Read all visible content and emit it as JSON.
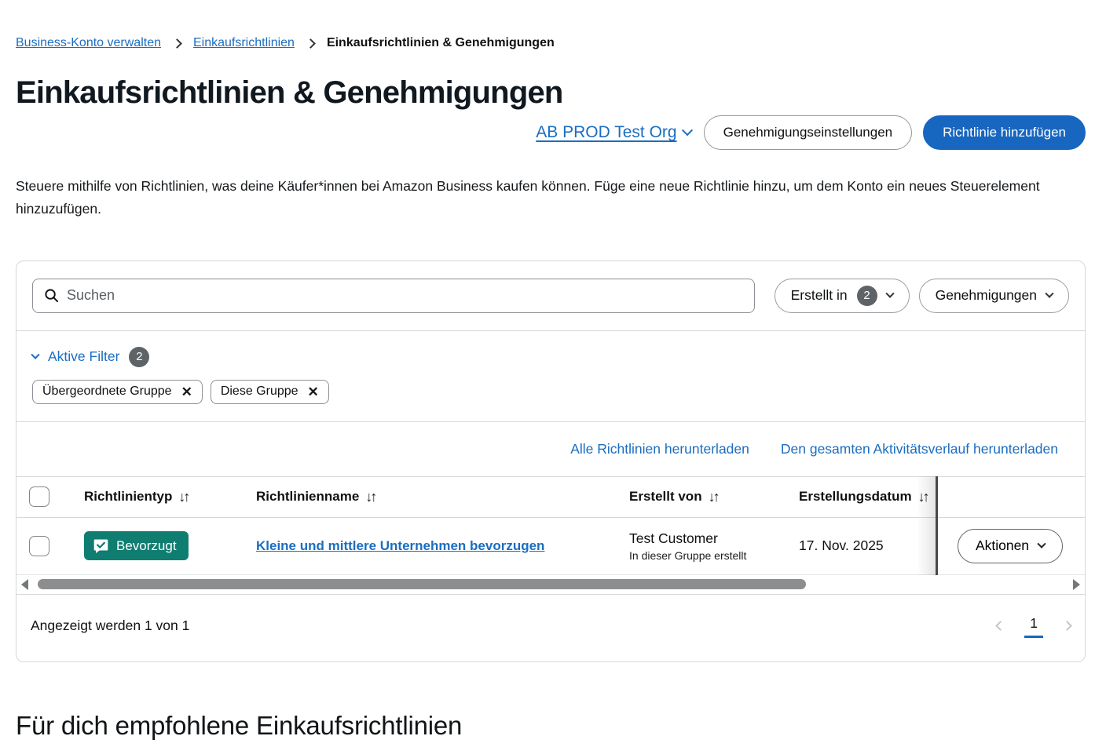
{
  "breadcrumb": {
    "link1": "Business-Konto verwalten",
    "link2": "Einkaufsrichtlinien",
    "current": "Einkaufsrichtlinien & Genehmigungen"
  },
  "page": {
    "title": "Einkaufsrichtlinien & Genehmigungen",
    "description": "Steuere mithilfe von Richtlinien, was deine Käufer*innen bei Amazon Business kaufen können. Füge eine neue Richtlinie hinzu, um dem Konto ein neues Steuerelement hinzuzufügen."
  },
  "header_controls": {
    "org_selector": "AB PROD Test Org",
    "settings_button": "Genehmigungseinstellungen",
    "add_policy_button": "Richtlinie hinzufügen"
  },
  "filters": {
    "search_placeholder": "Suchen",
    "created_in_label": "Erstellt in",
    "created_in_count": "2",
    "approvals_label": "Genehmigungen",
    "active_filters_label": "Aktive Filter",
    "active_filters_count": "2",
    "chip1": "Übergeordnete Gruppe",
    "chip2": "Diese Gruppe",
    "chip_remove_icon": "✕"
  },
  "links": {
    "download_policies": "Alle Richtlinien herunterladen",
    "download_activity": "Den gesamten Aktivitätsverlauf herunterladen"
  },
  "table": {
    "sort_icon": "↓↑",
    "columns": {
      "type": "Richtlinientyp",
      "name": "Richtlinienname",
      "created_by": "Erstellt von",
      "created_date": "Erstellungsdatum"
    },
    "rows": [
      {
        "type_badge": "Bevorzugt",
        "name": "Kleine und mittlere Unternehmen bevorzugen",
        "created_by": "Test Customer",
        "created_by_sub": "In dieser Gruppe erstellt",
        "date": "17. Nov. 2025",
        "actions_label": "Aktionen"
      }
    ]
  },
  "pagination": {
    "summary": "Angezeigt werden 1 von 1",
    "current_page": "1"
  },
  "recommended": {
    "title": "Für dich empfohlene Einkaufsrichtlinien"
  },
  "colors": {
    "link_blue": "#1b6dc0",
    "primary_button_blue": "#1766c0",
    "badge_teal": "#0f7d70",
    "count_badge_gray": "#5e6367",
    "border_gray": "#d5d9d9",
    "text_dark": "#0f1111"
  }
}
